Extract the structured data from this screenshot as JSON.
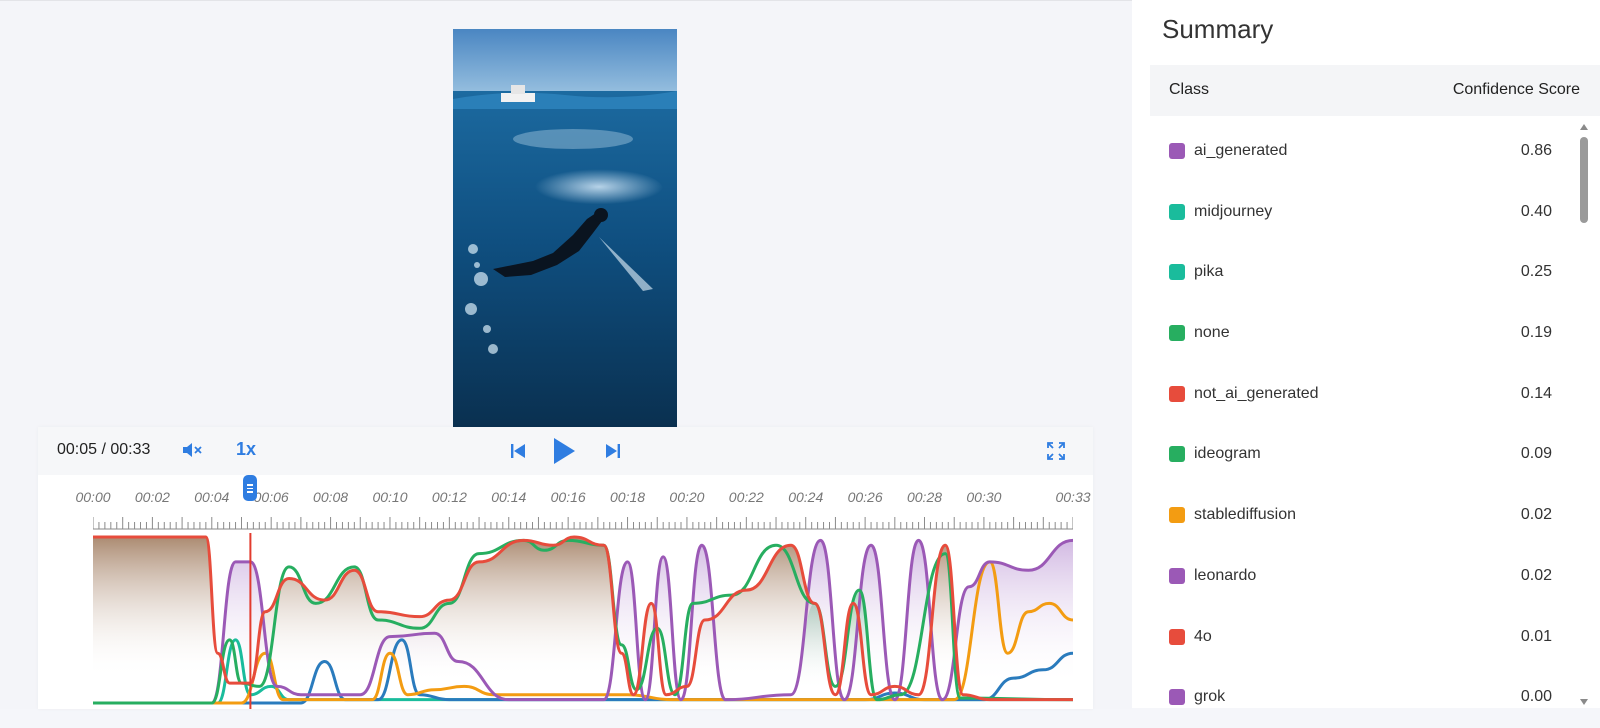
{
  "player": {
    "time": "00:05 / 00:33",
    "speed": "1x",
    "current_seconds": 5.3,
    "duration_seconds": 33,
    "ticks": [
      "00:00",
      "00:02",
      "00:04",
      "00:06",
      "00:08",
      "00:10",
      "00:12",
      "00:14",
      "00:16",
      "00:18",
      "00:20",
      "00:22",
      "00:24",
      "00:26",
      "00:28",
      "00:30",
      "00:33"
    ],
    "icons": {
      "mute": "muted-speaker-icon",
      "prev": "skip-previous-icon",
      "play": "play-icon",
      "next": "skip-next-icon",
      "fullscreen": "fullscreen-icon",
      "scrubber": "scrubber-handle-icon"
    },
    "accent_color": "#2f7de1",
    "playhead_color": "#e23b2e"
  },
  "summary": {
    "title": "Summary",
    "col_class": "Class",
    "col_score": "Confidence Score",
    "rows": [
      {
        "label": "ai_generated",
        "score": "0.86",
        "color": "#9b59b6"
      },
      {
        "label": "midjourney",
        "score": "0.40",
        "color": "#1abc9c"
      },
      {
        "label": "pika",
        "score": "0.25",
        "color": "#1abc9c"
      },
      {
        "label": "none",
        "score": "0.19",
        "color": "#27ae60"
      },
      {
        "label": "not_ai_generated",
        "score": "0.14",
        "color": "#e74c3c"
      },
      {
        "label": "ideogram",
        "score": "0.09",
        "color": "#27ae60"
      },
      {
        "label": "stablediffusion",
        "score": "0.02",
        "color": "#f39c12"
      },
      {
        "label": "leonardo",
        "score": "0.02",
        "color": "#9b59b6"
      },
      {
        "label": "4o",
        "score": "0.01",
        "color": "#e74c3c"
      },
      {
        "label": "grok",
        "score": "0.00",
        "color": "#9b59b6"
      }
    ]
  }
}
